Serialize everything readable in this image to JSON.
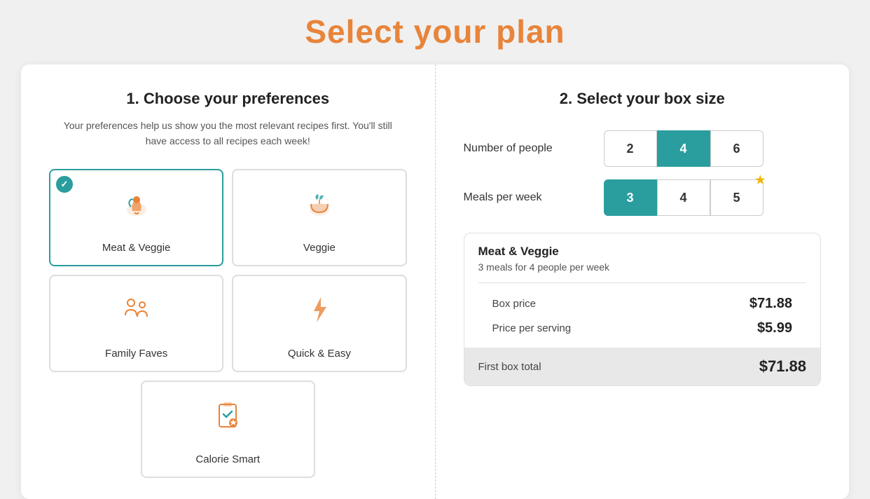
{
  "page": {
    "title": "Select your plan",
    "background": "#f0f0f0"
  },
  "left": {
    "section_number": "1.",
    "section_title": "1. Choose your preferences",
    "subtitle_line1": "Your preferences help us show you the most relevant recipes first. You'll still",
    "subtitle_line2": "have access to all recipes each week!",
    "preferences": [
      {
        "id": "meat-veggie",
        "label": "Meat & Veggie",
        "icon": "meat-veggie-icon",
        "selected": true
      },
      {
        "id": "veggie",
        "label": "Veggie",
        "icon": "veggie-icon",
        "selected": false
      },
      {
        "id": "family-faves",
        "label": "Family Faves",
        "icon": "family-faves-icon",
        "selected": false
      },
      {
        "id": "quick-easy",
        "label": "Quick & Easy",
        "icon": "quick-easy-icon",
        "selected": false
      }
    ],
    "bottom_preference": {
      "id": "calorie-smart",
      "label": "Calorie Smart",
      "icon": "calorie-smart-icon",
      "selected": false
    }
  },
  "right": {
    "section_title": "2. Select your box size",
    "number_of_people_label": "Number of people",
    "number_options": [
      2,
      4,
      6
    ],
    "number_selected": 4,
    "meals_per_week_label": "Meals per week",
    "meals_options": [
      3,
      4,
      5
    ],
    "meals_selected": 3,
    "meals_star_option": 5,
    "pricing": {
      "plan_name": "Meat & Veggie",
      "description": "3 meals for 4 people per week",
      "box_price_label": "Box price",
      "box_price_value": "$71.88",
      "price_per_serving_label": "Price per serving",
      "price_per_serving_value": "$5.99",
      "first_box_total_label": "First box total",
      "first_box_total_value": "$71.88"
    }
  }
}
